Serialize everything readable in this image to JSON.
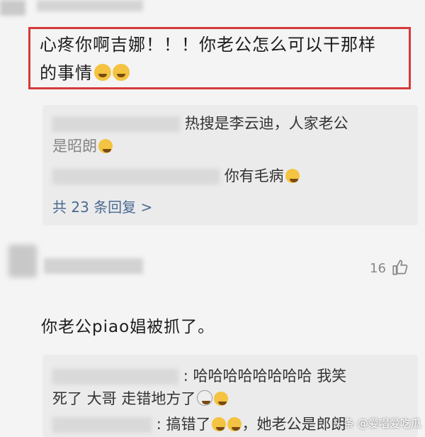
{
  "comment1": {
    "line1": "心疼你啊吉娜！！！你老公怎么可以干那样",
    "line2": "的事情"
  },
  "replies1": {
    "reply1_line1": "热搜是李云迪，人家老公",
    "reply1_line2": "是昭朗",
    "reply2": "你有毛病",
    "more": "共 23 条回复 >"
  },
  "comment2": {
    "likes": "16",
    "text": "你老公piao娼被抓了。"
  },
  "replies2": {
    "reply1_line1": ": 哈哈哈哈哈哈哈哈 我笑",
    "reply1_line2": "死了 大哥 走错地方了",
    "reply2": ": 搞错了",
    "reply2_tail": "，她老公是郎朗"
  },
  "watermark": "头条 @爱唱爱吃瓜",
  "colors": {
    "highlight": "#d63a3a",
    "link": "#4a6a92",
    "background": "#f4f4f4"
  },
  "icons": [
    "crying-emoji-icon",
    "laughing-emoji-icon",
    "thumbs-up-icon"
  ]
}
